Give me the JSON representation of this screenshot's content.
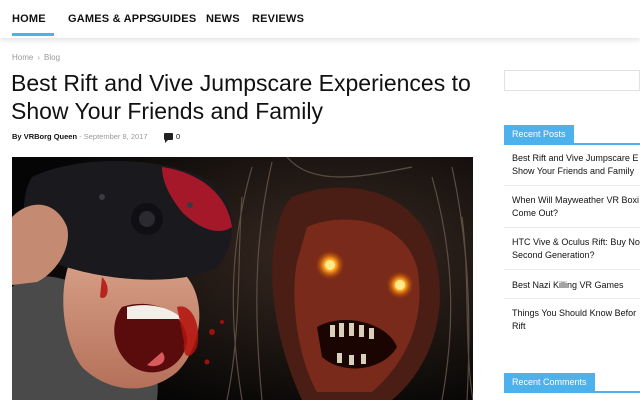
{
  "nav": {
    "items": [
      {
        "label": "HOME",
        "active": true
      },
      {
        "label": "GAMES & APPS",
        "active": false
      },
      {
        "label": "GUIDES",
        "active": false
      },
      {
        "label": "NEWS",
        "active": false
      },
      {
        "label": "REVIEWS",
        "active": false
      }
    ],
    "accent_color": "#4db2ec"
  },
  "breadcrumb": {
    "items": [
      "Home",
      "Blog"
    ],
    "separator": "›"
  },
  "article": {
    "title": "Best Rift and Vive Jumpscare Experiences to Show Your Friends and Family",
    "meta": {
      "by": "By",
      "author": "VRBorg Queen",
      "dash": "-",
      "date": "September 8, 2017",
      "comment_count": "0"
    }
  },
  "sidebar": {
    "recent_posts": {
      "heading": "Recent Posts",
      "items": [
        "Best Rift and Vive Jumpscare E\nShow Your Friends and Family",
        "When Will Mayweather VR Boxi\nCome Out?",
        "HTC Vive & Oculus Rift: Buy No\nSecond Generation?",
        "Best Nazi Killing VR Games",
        "Things You Should Know Befor\nRift"
      ]
    },
    "recent_comments": {
      "heading": "Recent Comments"
    }
  }
}
